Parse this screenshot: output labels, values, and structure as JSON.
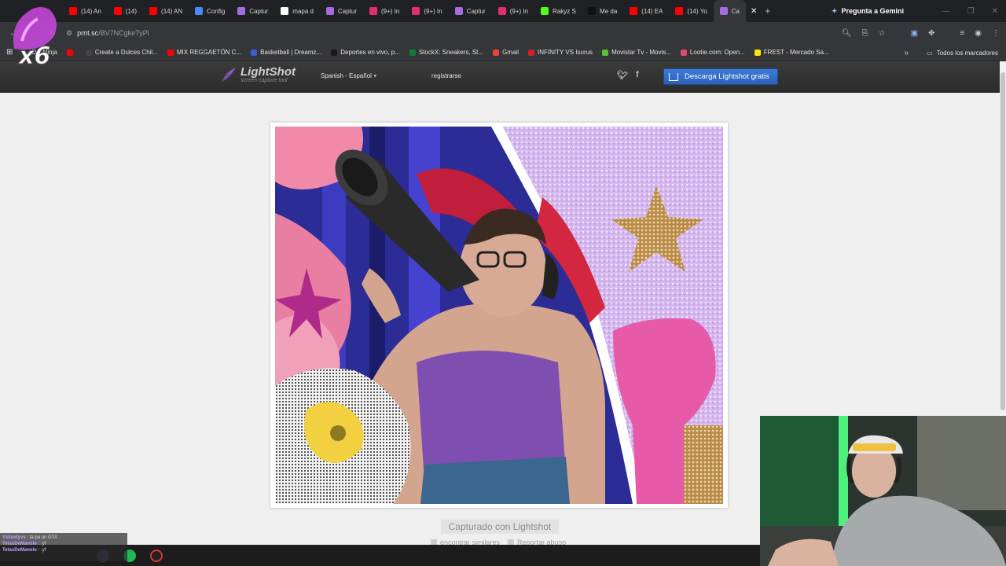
{
  "browser": {
    "tabs": [
      {
        "label": "(14) An",
        "icon": "youtube-icon",
        "color": "#ff0000"
      },
      {
        "label": "(14)",
        "icon": "youtube-icon",
        "color": "#ff0000"
      },
      {
        "label": "(14) AN",
        "icon": "youtube-icon",
        "color": "#ff0000"
      },
      {
        "label": "Config",
        "icon": "gear-icon",
        "color": "#4a8af4"
      },
      {
        "label": "Captur",
        "icon": "lightshot-icon",
        "color": "#a56be0"
      },
      {
        "label": "mapa d",
        "icon": "google-icon",
        "color": "#ffffff"
      },
      {
        "label": "Captur",
        "icon": "lightshot-icon",
        "color": "#a56be0"
      },
      {
        "label": "(9+) In",
        "icon": "instagram-icon",
        "color": "#e1306c"
      },
      {
        "label": "(9+) In",
        "icon": "instagram-icon",
        "color": "#e1306c"
      },
      {
        "label": "Captur",
        "icon": "lightshot-icon",
        "color": "#a56be0"
      },
      {
        "label": "(9+) In",
        "icon": "instagram-icon",
        "color": "#e1306c"
      },
      {
        "label": "Rakyz S",
        "icon": "kick-icon",
        "color": "#53fc18"
      },
      {
        "label": "Me da",
        "icon": "tiktok-icon",
        "color": "#111111"
      },
      {
        "label": "(14) EA",
        "icon": "youtube-icon",
        "color": "#ff0000"
      },
      {
        "label": "(14) Yo",
        "icon": "youtube-icon",
        "color": "#ff0000"
      },
      {
        "label": "Ca",
        "icon": "lightshot-icon",
        "color": "#a56be0"
      }
    ],
    "gemini_label": "Pregunta a Gemini",
    "url_host": "prnt.sc",
    "url_path": "/BV7NCgkeTyPi",
    "bookmarks": [
      {
        "label": "DO.Ninja",
        "color": "#333333"
      },
      {
        "label": "",
        "color": "#ff0000"
      },
      {
        "label": "Create a Dulces Chil...",
        "color": "#444444"
      },
      {
        "label": "MIX REGGAETÓN C...",
        "color": "#ff0000"
      },
      {
        "label": "Basketball | Dreamz...",
        "color": "#3b5bdb"
      },
      {
        "label": "Deportes en vivo, p...",
        "color": "#1a1a1a"
      },
      {
        "label": "StockX: Sneakers, St...",
        "color": "#0a7d3b"
      },
      {
        "label": "Gmail",
        "color": "#ea4335"
      },
      {
        "label": "INFINITY VS Isurus",
        "color": "#d11f2c"
      },
      {
        "label": "Movistar Tv - Movis...",
        "color": "#5bc236"
      },
      {
        "label": "Lootie.com: Open...",
        "color": "#e14b6e"
      },
      {
        "label": "FREST - Mercado Sa...",
        "color": "#ffe600"
      }
    ],
    "all_bookmarks_label": "Todos los marcadores"
  },
  "lightshot": {
    "logo_name": "LightShot",
    "logo_sub": "screen capture tool",
    "language": "Spanish - Español",
    "register": "registrarse",
    "download_button": "Descarga Lightshot gratis",
    "captured_label": "Capturado con Lightshot",
    "find_similar": "encontrar similares",
    "report_abuse": "Reportar abuso"
  },
  "overlay": {
    "multiplier": "x6",
    "chat": [
      {
        "user": "Ysilantyvs",
        "msg": "ta pa un GTA"
      },
      {
        "user": "TetasDeManolo",
        "msg": ":yf"
      },
      {
        "user": "TetasDeManolo",
        "msg": ":yf"
      }
    ]
  }
}
